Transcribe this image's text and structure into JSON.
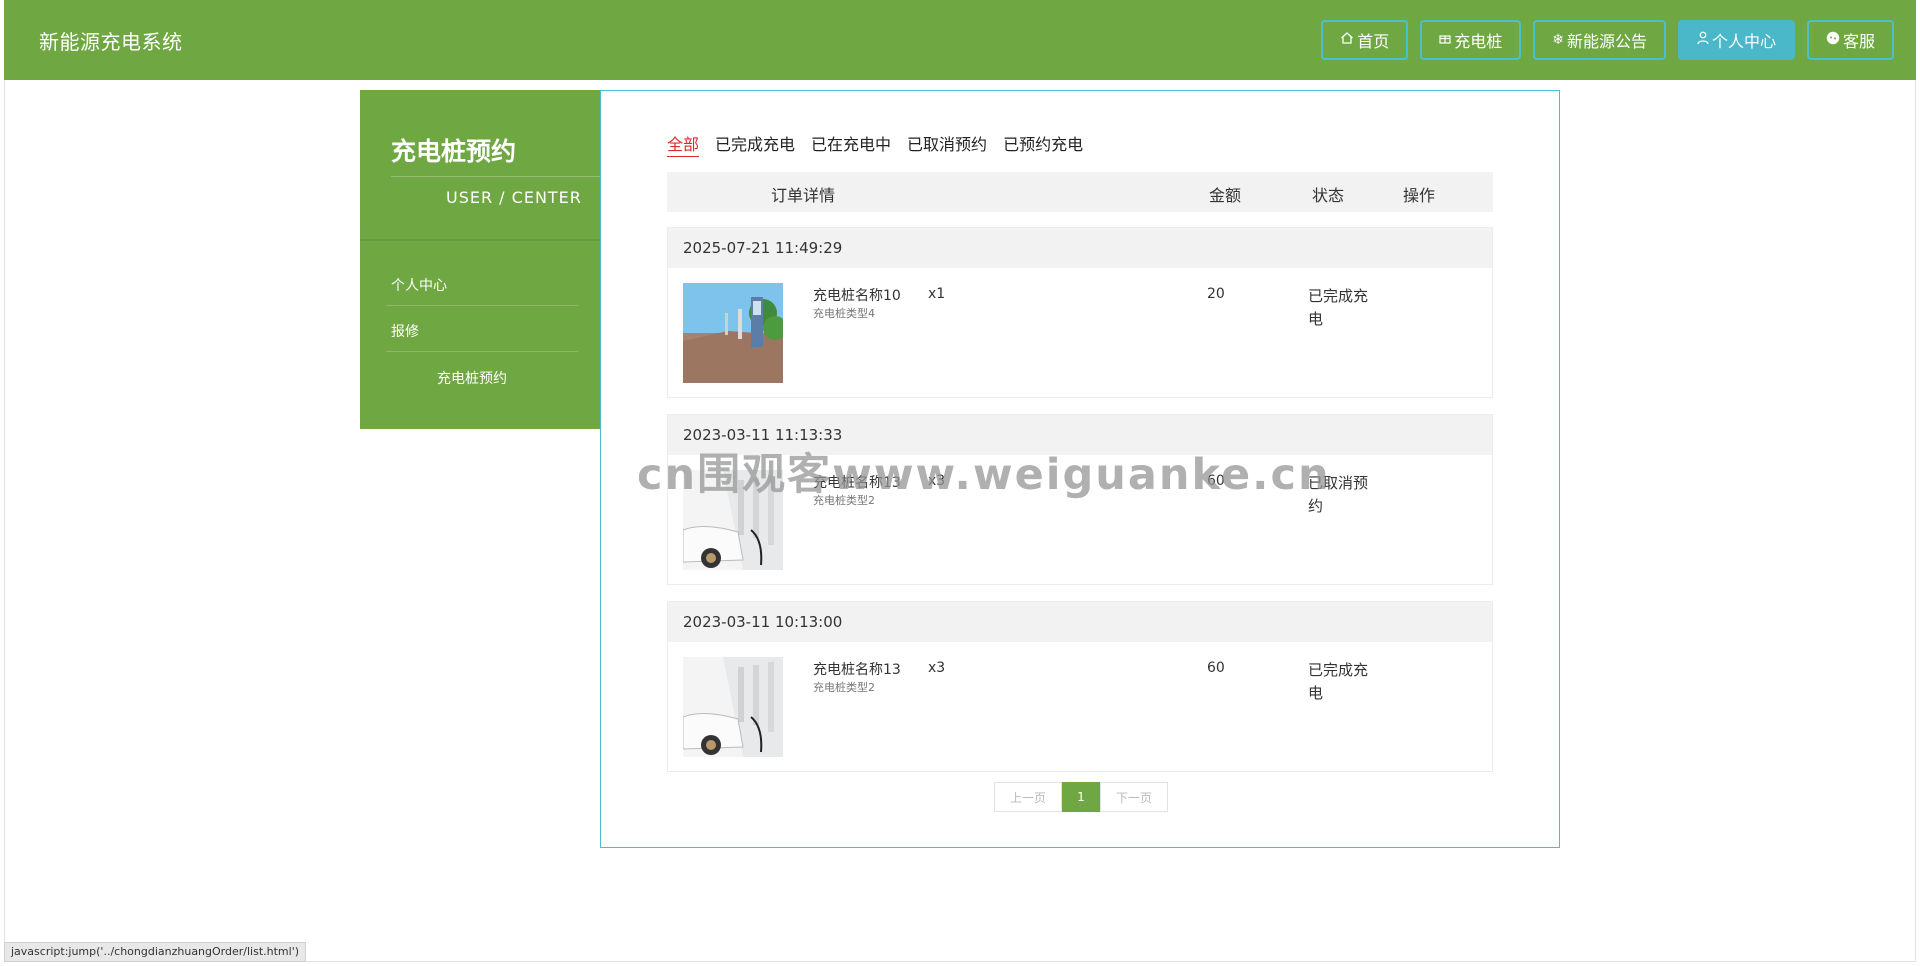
{
  "header": {
    "brand": "新能源充电系统",
    "nav": [
      {
        "label": "首页",
        "icon": "home-icon"
      },
      {
        "label": "充电桩",
        "icon": "gift-icon"
      },
      {
        "label": "新能源公告",
        "icon": "snowflake-icon"
      },
      {
        "label": "个人中心",
        "icon": "user-icon",
        "active": true
      },
      {
        "label": "客服",
        "icon": "chat-icon"
      }
    ]
  },
  "sidebar": {
    "title": "充电桩预约",
    "subtitle": "USER / CENTER",
    "items": [
      {
        "label": "个人中心"
      },
      {
        "label": "报修"
      },
      {
        "label": "充电桩预约"
      }
    ]
  },
  "tabs": [
    "全部",
    "已完成充电",
    "已在充电中",
    "已取消预约",
    "已预约充电"
  ],
  "active_tab": "全部",
  "table_header": {
    "detail": "订单详情",
    "amount": "金额",
    "status": "状态",
    "action": "操作"
  },
  "orders": [
    {
      "time": "2025-07-21 11:49:29",
      "name": "充电桩名称10",
      "type": "充电桩类型4",
      "qty": "x1",
      "amount": "20",
      "status": "已完成充电"
    },
    {
      "time": "2023-03-11 11:13:33",
      "name": "充电桩名称13",
      "type": "充电桩类型2",
      "qty": "x3",
      "amount": "60",
      "status": "已取消预约"
    },
    {
      "time": "2023-03-11 10:13:00",
      "name": "充电桩名称13",
      "type": "充电桩类型2",
      "qty": "x3",
      "amount": "60",
      "status": "已完成充电"
    }
  ],
  "pager": {
    "prev": "上一页",
    "current": "1",
    "next": "下一页"
  },
  "watermark": "cn围观客www.weiguanke.cn",
  "status_bar": "javascript:jump('../chongdianzhuangOrder/list.html')",
  "colors": {
    "primary_green": "#6fa842",
    "accent_cyan": "#4ac0cf",
    "active_tab_red": "#e02b2b"
  }
}
